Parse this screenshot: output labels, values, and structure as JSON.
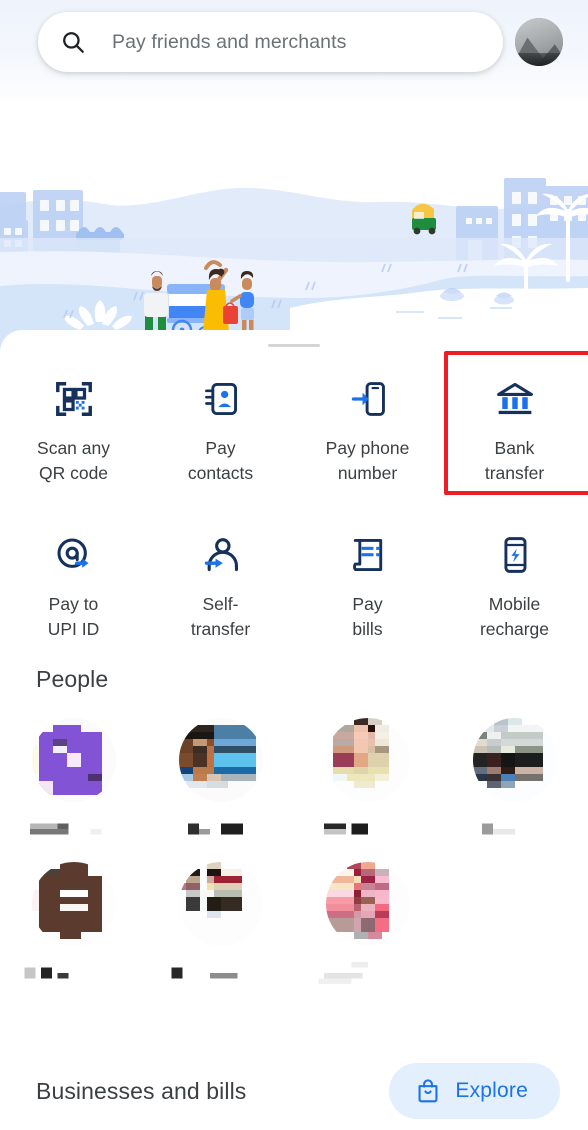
{
  "header": {
    "search": {
      "icon": "search-icon",
      "placeholder": "Pay friends and merchants",
      "value": ""
    },
    "profile": {
      "icon": "account-avatar",
      "label": ""
    }
  },
  "hero": {
    "illustration_name": "city-street-scene-illustration",
    "elements": [
      "buildings",
      "shop-awning",
      "food-cart",
      "family-people",
      "child",
      "auto-rickshaw",
      "palm-trees",
      "lotus-flowers",
      "water"
    ]
  },
  "sheet": {
    "drag_handle": "sheet-drag-handle",
    "actions": [
      {
        "id": "scan-qr",
        "icon": "qr-code-icon",
        "label": "Scan any\nQR code",
        "line1": "Scan any",
        "line2": "QR code",
        "highlighted": false
      },
      {
        "id": "pay-contacts",
        "icon": "contacts-book-icon",
        "label": "Pay\ncontacts",
        "line1": "Pay",
        "line2": "contacts",
        "highlighted": false
      },
      {
        "id": "pay-phone",
        "icon": "phone-arrow-icon",
        "label": "Pay phone\nnumber",
        "line1": "Pay phone",
        "line2": "number",
        "highlighted": false
      },
      {
        "id": "bank-transfer",
        "icon": "bank-icon",
        "label": "Bank\ntransfer",
        "line1": "Bank",
        "line2": "transfer",
        "highlighted": true
      },
      {
        "id": "pay-upi-id",
        "icon": "at-sign-arrow-icon",
        "label": "Pay to\nUPI ID",
        "line1": "Pay to",
        "line2": "UPI ID",
        "highlighted": false
      },
      {
        "id": "self-transfer",
        "icon": "person-arrow-icon",
        "label": "Self-\ntransfer",
        "line1": "Self-",
        "line2": "transfer",
        "highlighted": false
      },
      {
        "id": "pay-bills",
        "icon": "bill-receipt-icon",
        "label": "Pay\nbills",
        "line1": "Pay",
        "line2": "bills",
        "highlighted": false
      },
      {
        "id": "mobile-recharge",
        "icon": "phone-bolt-icon",
        "label": "Mobile\nrecharge",
        "line1": "Mobile",
        "line2": "recharge",
        "highlighted": false
      }
    ],
    "people": {
      "title": "People",
      "contacts": [
        {
          "id": "contact-1",
          "name": "",
          "avatar_redacted": true,
          "avatar_tone": "#8253d4"
        },
        {
          "id": "contact-2",
          "name": "",
          "avatar_redacted": true,
          "avatar_tone": "#4a7fae"
        },
        {
          "id": "contact-3",
          "name": "",
          "avatar_redacted": true,
          "avatar_tone": "#d9b79a"
        },
        {
          "id": "contact-4",
          "name": "",
          "avatar_redacted": true,
          "avatar_tone": "#9aa0a2"
        },
        {
          "id": "contact-5",
          "name": "",
          "avatar_redacted": true,
          "avatar_tone": "#5b3b2e"
        },
        {
          "id": "contact-6",
          "name": "",
          "avatar_redacted": true,
          "avatar_tone": "#8d6a61"
        },
        {
          "id": "contact-7",
          "name": "",
          "avatar_redacted": true,
          "avatar_tone": "#e08a9a"
        }
      ]
    },
    "businesses": {
      "title": "Businesses and bills",
      "explore_label": "Explore",
      "explore_icon": "shopping-bag-icon"
    }
  },
  "colors": {
    "accent_blue": "#1a73e8",
    "icon_navy": "#16325c",
    "icon_blue": "#1a73e8",
    "highlight_red": "#ee1c25",
    "chip_bg": "#e3effd",
    "text_primary": "#3c4043",
    "text_secondary": "#6b7177"
  }
}
